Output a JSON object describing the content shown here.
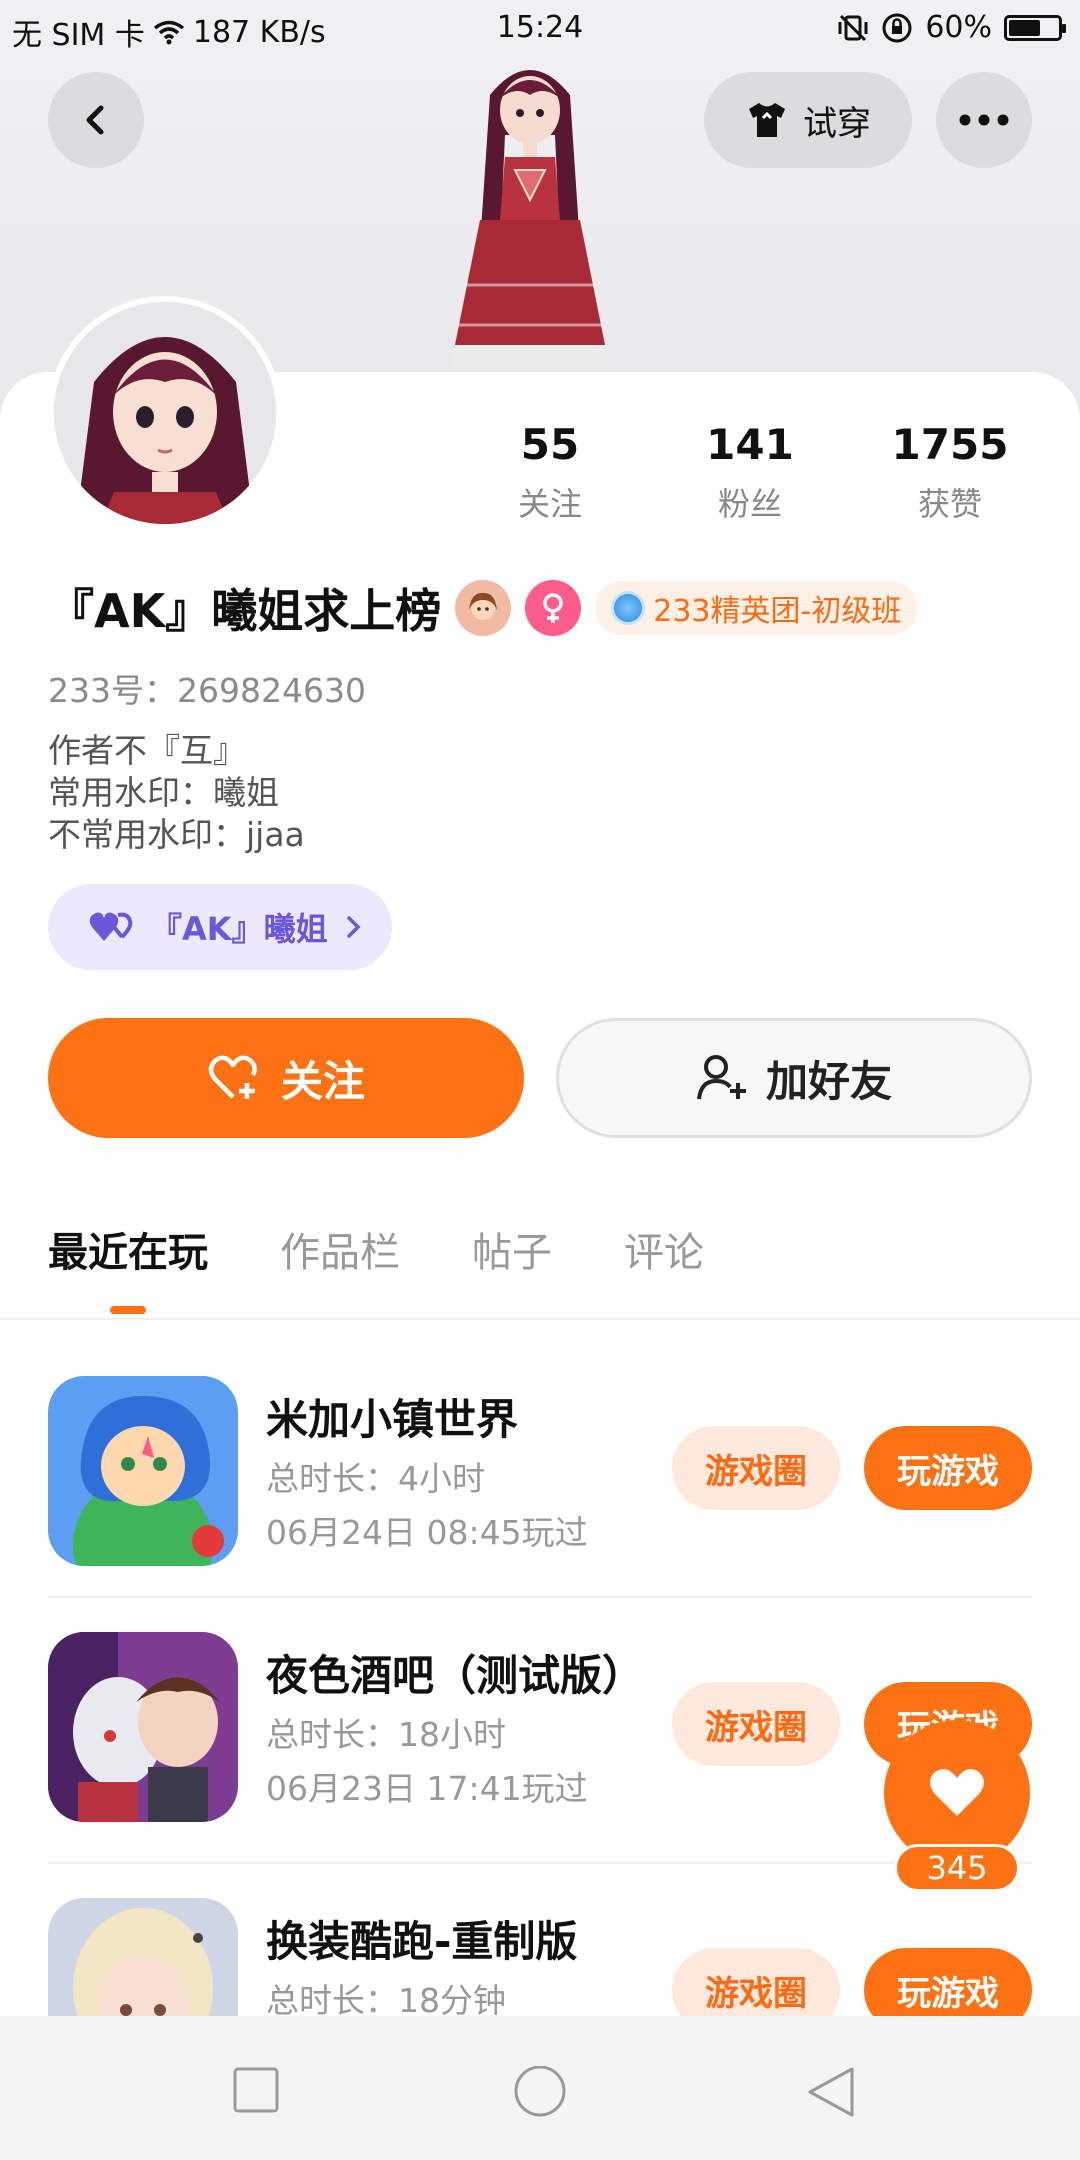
{
  "status_bar": {
    "carrier": "无 SIM 卡",
    "speed": "187 KB/s",
    "time": "15:24",
    "battery": "60%",
    "battery_level": 0.6
  },
  "header": {
    "back_icon": "chevron-left-icon",
    "tryon_label": "试穿",
    "tryon_icon": "shirt-icon",
    "more_icon": "more-dots-icon"
  },
  "profile": {
    "stats": [
      {
        "value": "55",
        "label": "关注"
      },
      {
        "value": "141",
        "label": "粉丝"
      },
      {
        "value": "1755",
        "label": "获赞"
      }
    ],
    "name": "『AK』曦姐求上榜",
    "badge": "233精英团-初级班",
    "uid_label": "233号：269824630",
    "bio_lines": [
      "作者不『互』",
      "常用水印：曦姐",
      "不常用水印：jjaa"
    ],
    "fans_tag": "『AK』曦姐"
  },
  "actions": {
    "follow": "关注",
    "add_friend": "加好友"
  },
  "tabs": [
    {
      "label": "最近在玩",
      "active": true
    },
    {
      "label": "作品栏",
      "active": false
    },
    {
      "label": "帖子",
      "active": false
    },
    {
      "label": "评论",
      "active": false
    }
  ],
  "games": [
    {
      "title": "米加小镇世界",
      "duration": "总时长：4小时",
      "last_played": "06月24日 08:45玩过",
      "circle": "游戏圈",
      "play": "玩游戏"
    },
    {
      "title": "夜色酒吧（测试版）",
      "duration": "总时长：18小时",
      "last_played": "06月23日 17:41玩过",
      "circle": "游戏圈",
      "play": "玩游戏"
    },
    {
      "title": "换装酷跑-重制版",
      "duration": "总时长：18分钟",
      "last_played": "",
      "circle": "游戏圈",
      "play": "玩游戏"
    }
  ],
  "like": {
    "count": "345"
  },
  "colors": {
    "accent": "#ff7214",
    "badge_bg": "#fff0e6",
    "fans_tag_bg": "#ece9ff",
    "fans_tag_text": "#6a57d9"
  }
}
